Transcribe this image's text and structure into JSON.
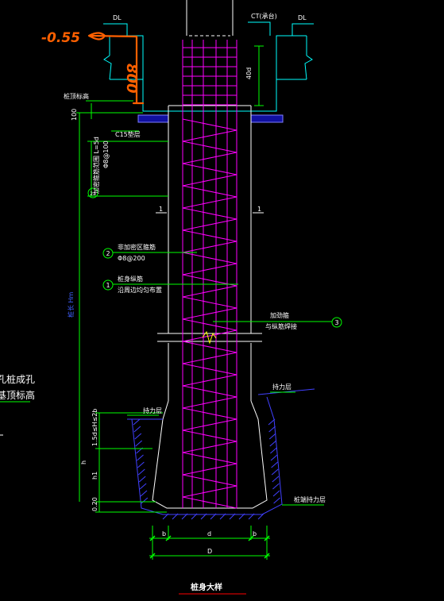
{
  "labels": {
    "handwritten_elevation": "-0.55",
    "handwritten_depth": "800",
    "dl_left": "DL",
    "dl_right": "DL",
    "ct_label": "CT(承台)",
    "anchor_len": "40d",
    "pile_top_elev": "桩顶标高",
    "pile_top_dim": "100",
    "c15_cushion": "C15垫层",
    "rebar_spec_top": "加密箍筋范围 L=5d",
    "rebar_spec_sub": "Φ8@100",
    "circle_2a": "2a",
    "circle_2": "2",
    "spiral_label": "非加密区箍筋",
    "spiral_spec": "Φ8@200",
    "circle_1": "1",
    "main_bar_label": "桩身纵筋",
    "main_bar_spec": "沿周边均匀布置",
    "circle_3": "3",
    "stiff_ring": "加劲箍",
    "stiff_ring_spec": "与纵筋焊接",
    "section_mark_left": "1",
    "section_mark_right": "1",
    "pile_length": "桩长 Hm",
    "left_note_1": "孔桩成孔",
    "left_note_2": "基顶标高",
    "bearing_layer_right": "持力层",
    "bearing_layer_left": "持力层",
    "bell_dim_1": "1.5d≤H≤2b",
    "bell_dim_h": "h",
    "bell_dim_h1": "h1",
    "bell_dim_base": "0.20",
    "bearing_stratum": "桩端持力层",
    "dim_b_left": "b",
    "dim_d": "d",
    "dim_b_right": "b",
    "dim_D": "D",
    "title": "桩身大样"
  },
  "colors": {
    "background": "#000000",
    "concrete_outline": "#ffffff",
    "cap_outline": "#00ffff",
    "rebar": "#ff00ff",
    "dimension": "#00ff00",
    "soil_hatch": "#4040ff",
    "handwriting": "#ff6000",
    "title_underline": "#ff0000",
    "text": "#ffffff",
    "marker": "#ffff00"
  }
}
